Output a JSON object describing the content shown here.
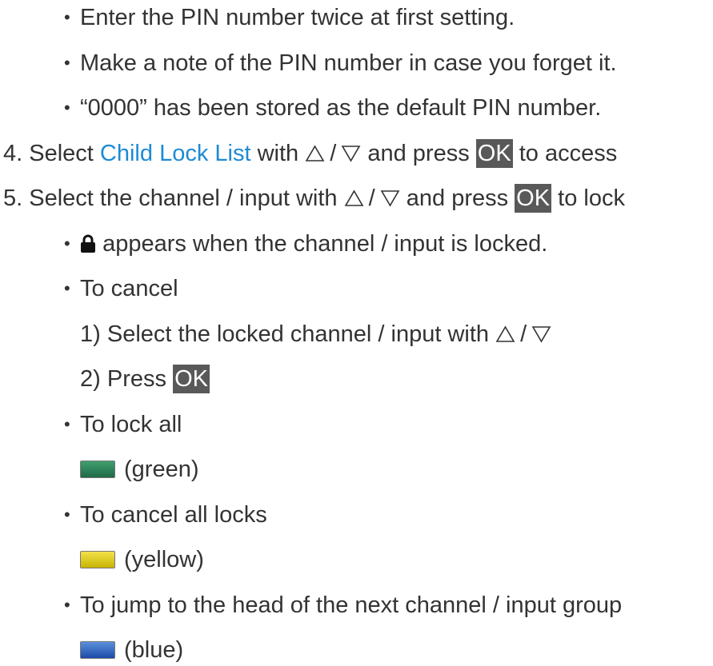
{
  "bullets_top": [
    "Enter the PIN number twice at first setting.",
    "Make a note of the PIN number in case you forget it.",
    "“0000” has been stored as the default PIN number."
  ],
  "step4": {
    "number": "4.",
    "prefix": "Select",
    "link": "Child Lock List",
    "mid": "with",
    "after": "and press",
    "key": "OK",
    "suffix": "to access"
  },
  "step5": {
    "number": "5.",
    "prefix": "Select the channel / input with",
    "after": "and press",
    "key": "OK",
    "suffix": "to lock"
  },
  "lock_note": "appears when the channel / input is locked.",
  "cancel": {
    "title": "To cancel",
    "sub1_num": "1)",
    "sub1_text": "Select the locked channel / input with",
    "sub2_num": "2)",
    "sub2_text": "Press",
    "key": "OK"
  },
  "lock_all": {
    "title": "To lock all",
    "button": "(green)"
  },
  "cancel_all": {
    "title": "To cancel all locks",
    "button": "(yellow)"
  },
  "jump": {
    "title": "To jump to the head of the next channel / input group",
    "button": "(blue)"
  },
  "slash": "/",
  "colors": {
    "link": "#1e8ad6",
    "key_bg": "#595959",
    "green": "#2e8a5c",
    "yellow": "#e4d21c",
    "blue": "#3766c4"
  },
  "icons": [
    "up-triangle-icon",
    "down-triangle-icon",
    "padlock-icon"
  ]
}
